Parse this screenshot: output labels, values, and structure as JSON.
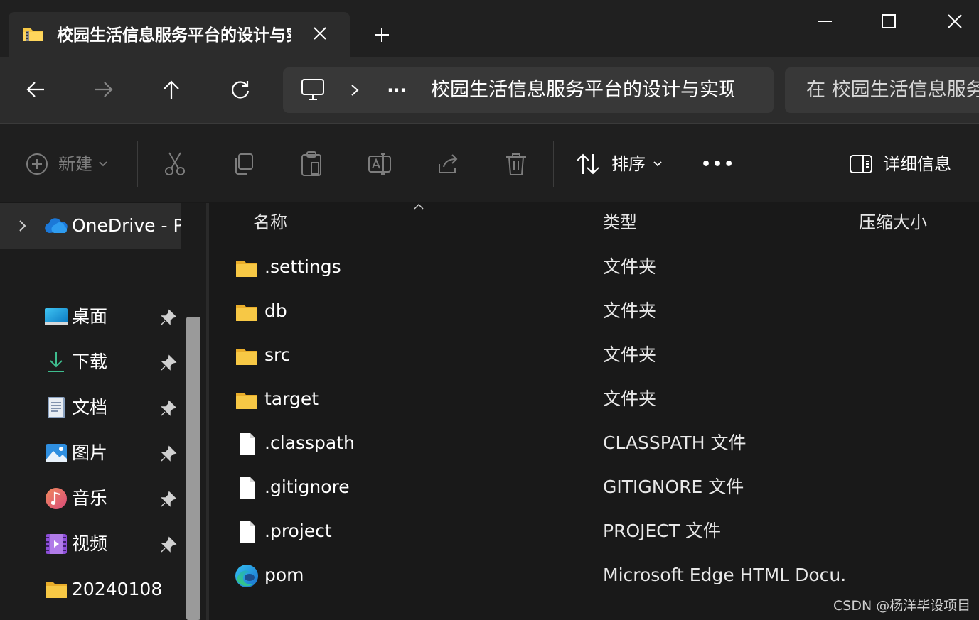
{
  "tab": {
    "title": "校园生活信息服务平台的设计与实现",
    "icon": "zip-folder-icon"
  },
  "window_controls": [
    "minimize-icon",
    "maximize-icon",
    "close-icon"
  ],
  "nav": {
    "back_icon": "arrow-left-icon",
    "forward_icon": "arrow-right-icon",
    "up_icon": "arrow-up-icon",
    "refresh_icon": "refresh-icon"
  },
  "address": {
    "more": "···",
    "path": "校园生活信息服务平台的设计与实现"
  },
  "search": {
    "placeholder": "在 校园生活信息服务平台的设计与实现 中搜索"
  },
  "toolbar": {
    "new_label": "新建",
    "sort_label": "排序",
    "more_label": "•••",
    "details_label": "详细信息"
  },
  "sidebar": {
    "onedrive_label": "OneDrive - Personal",
    "items": [
      {
        "label": "桌面",
        "icon": "desktop-icon",
        "pinned": true
      },
      {
        "label": "下载",
        "icon": "download-icon",
        "pinned": true
      },
      {
        "label": "文档",
        "icon": "documents-icon",
        "pinned": true
      },
      {
        "label": "图片",
        "icon": "pictures-icon",
        "pinned": true
      },
      {
        "label": "音乐",
        "icon": "music-icon",
        "pinned": true
      },
      {
        "label": "视频",
        "icon": "videos-icon",
        "pinned": true
      },
      {
        "label": "20240108",
        "icon": "folder-icon",
        "pinned": false
      }
    ]
  },
  "columns": {
    "name": "名称",
    "type": "类型",
    "size": "压缩大小"
  },
  "files": [
    {
      "name": ".settings",
      "type": "文件夹",
      "icon": "folder-icon"
    },
    {
      "name": "db",
      "type": "文件夹",
      "icon": "folder-icon"
    },
    {
      "name": "src",
      "type": "文件夹",
      "icon": "folder-icon"
    },
    {
      "name": "target",
      "type": "文件夹",
      "icon": "folder-icon"
    },
    {
      "name": ".classpath",
      "type": "CLASSPATH 文件",
      "icon": "file-icon"
    },
    {
      "name": ".gitignore",
      "type": "GITIGNORE 文件",
      "icon": "file-icon"
    },
    {
      "name": ".project",
      "type": "PROJECT 文件",
      "icon": "file-icon"
    },
    {
      "name": "pom",
      "type": "Microsoft Edge HTML Docu...",
      "icon": "edge-icon"
    }
  ],
  "watermark": "CSDN @杨洋毕设项目",
  "colors": {
    "folder": "#f7c845",
    "titlebar": "#202020",
    "navbar": "#2c2c2c",
    "content": "#191919"
  }
}
